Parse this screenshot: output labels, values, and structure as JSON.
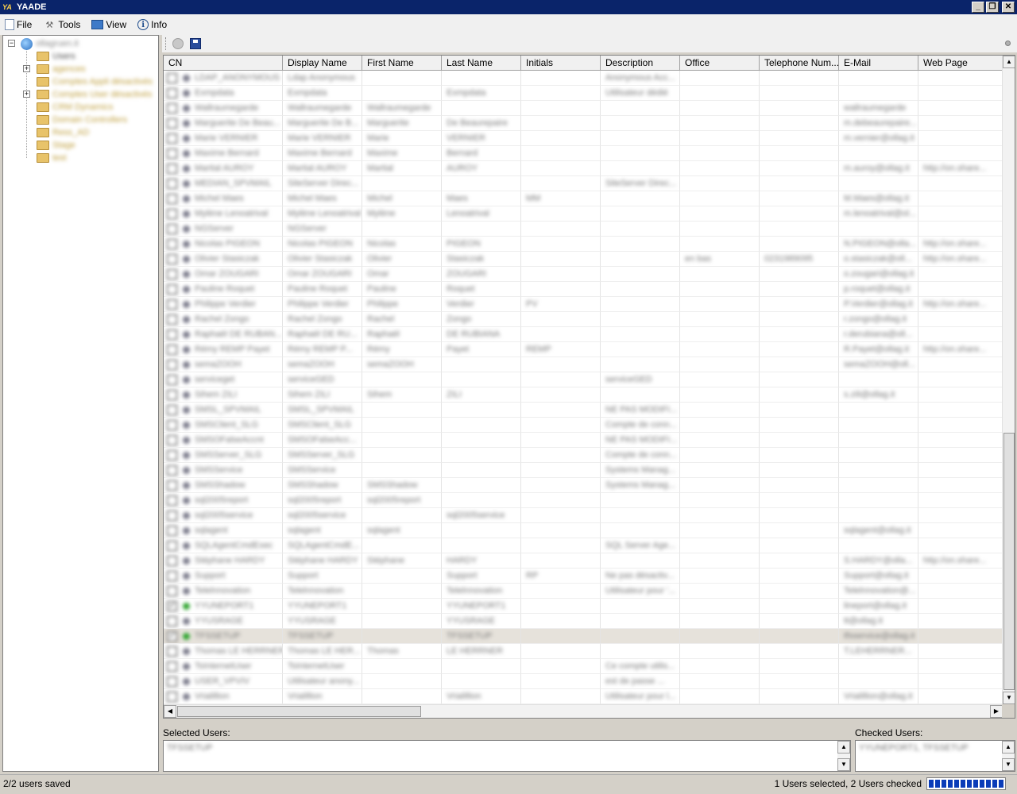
{
  "window": {
    "title": "YAADE",
    "app_icon": "YA"
  },
  "menu": [
    {
      "label": "File",
      "icon": "file-icon"
    },
    {
      "label": "Tools",
      "icon": "tools-icon"
    },
    {
      "label": "View",
      "icon": "view-icon"
    },
    {
      "label": "Info",
      "icon": "info-icon"
    }
  ],
  "tree": {
    "root": "ollagruen.it",
    "items": [
      {
        "label": "Users",
        "expandable": false,
        "selected": true
      },
      {
        "label": "agences",
        "expandable": true
      },
      {
        "label": "Comptes Appli désactivés",
        "expandable": false
      },
      {
        "label": "Comptes User désactivés",
        "expandable": true
      },
      {
        "label": "CRM Dynamics",
        "expandable": false
      },
      {
        "label": "Domain Controllers",
        "expandable": false
      },
      {
        "label": "Ress_AD",
        "expandable": false
      },
      {
        "label": "Stage",
        "expandable": false
      },
      {
        "label": "test",
        "expandable": false
      }
    ]
  },
  "grid": {
    "columns": [
      "CN",
      "Display Name",
      "First Name",
      "Last Name",
      "Initials",
      "Description",
      "Office",
      "Telephone Num...",
      "E-Mail",
      "Web Page"
    ],
    "rows": [
      {
        "checked": false,
        "active": false,
        "cells": [
          "LDAP_ANONYMOUS",
          "Ldap Anonymous",
          "",
          "",
          "",
          "Anonymous Acc...",
          "",
          "",
          "",
          ""
        ]
      },
      {
        "checked": false,
        "active": false,
        "cells": [
          "Exmpdata",
          "Exmpdata",
          "",
          "Exmpdata",
          "",
          "Utilisateur dédié",
          "",
          "",
          "",
          ""
        ]
      },
      {
        "checked": false,
        "active": false,
        "cells": [
          "Wallraumegarde",
          "Wallraumegarde",
          "Wallraumegarde",
          "",
          "",
          "",
          "",
          "",
          "wallraumegarde",
          ""
        ]
      },
      {
        "checked": false,
        "active": false,
        "cells": [
          "Marguerite De Beau...",
          "Marguerite De B...",
          "Marguerite",
          "De Beaurepaire",
          "",
          "",
          "",
          "",
          "m.debeaurepaire...",
          ""
        ]
      },
      {
        "checked": false,
        "active": false,
        "cells": [
          "Marie VERNIER",
          "Marie VERNIER",
          "Marie",
          "VERNIER",
          "",
          "",
          "",
          "",
          "m.vernier@ollag.it",
          ""
        ]
      },
      {
        "checked": false,
        "active": false,
        "cells": [
          "Maxime Bernard",
          "Maxime Bernard",
          "Maxime",
          "Bernard",
          "",
          "",
          "",
          "",
          "",
          ""
        ]
      },
      {
        "checked": false,
        "active": false,
        "cells": [
          "Martial AUROY",
          "Martial AUROY",
          "Martial",
          "AUROY",
          "",
          "",
          "",
          "",
          "m.auroy@ollag.it",
          "http://on.share..."
        ]
      },
      {
        "checked": false,
        "active": false,
        "cells": [
          "MEDIAN_SPVMAIL",
          "SiteServer Direc...",
          "",
          "",
          "",
          "SiteServer Direc...",
          "",
          "",
          "",
          ""
        ]
      },
      {
        "checked": false,
        "active": false,
        "cells": [
          "Michel Maes",
          "Michel Maes",
          "Michel",
          "Maes",
          "MM",
          "",
          "",
          "",
          "M.Maes@ollag.it",
          ""
        ]
      },
      {
        "checked": false,
        "active": false,
        "cells": [
          "Mylène Lenoatrival",
          "Mylène Lenoatrival",
          "Mylène",
          "Lenoatrival",
          "",
          "",
          "",
          "",
          "m.lenoatrival@ol...",
          ""
        ]
      },
      {
        "checked": false,
        "active": false,
        "cells": [
          "NGServer",
          "NGServer",
          "",
          "",
          "",
          "",
          "",
          "",
          "",
          ""
        ]
      },
      {
        "checked": false,
        "active": false,
        "cells": [
          "Nicolas PIGEON",
          "Nicolas PIGEON",
          "Nicolas",
          "PIGEON",
          "",
          "",
          "",
          "",
          "N.PIGEON@olla...",
          "http://on.share..."
        ]
      },
      {
        "checked": false,
        "active": false,
        "cells": [
          "Olivier Stasiczak",
          "Olivier Stasiczak",
          "Olivier",
          "Stasiczak",
          "",
          "",
          "en bas",
          "0231989095",
          "o.stasiczak@oll...",
          "http://on.share..."
        ]
      },
      {
        "checked": false,
        "active": false,
        "cells": [
          "Omar ZOUGARI",
          "Omar ZOUGARI",
          "Omar",
          "ZOUGARI",
          "",
          "",
          "",
          "",
          "o.zougari@ollag.it",
          ""
        ]
      },
      {
        "checked": false,
        "active": false,
        "cells": [
          "Pauline Roquet",
          "Pauline Roquet",
          "Pauline",
          "Roquet",
          "",
          "",
          "",
          "",
          "p.roquet@ollag.it",
          ""
        ]
      },
      {
        "checked": false,
        "active": false,
        "cells": [
          "Philippe Verdier",
          "Philippe Verdier",
          "Philippe",
          "Verdier",
          "PV",
          "",
          "",
          "",
          "P.Verdier@ollag.it",
          "http://on.share..."
        ]
      },
      {
        "checked": false,
        "active": false,
        "cells": [
          "Rachel Zongo",
          "Rachel Zongo",
          "Rachel",
          "Zongo",
          "",
          "",
          "",
          "",
          "r.zongo@ollag.it",
          ""
        ]
      },
      {
        "checked": false,
        "active": false,
        "cells": [
          "Raphaël DE RUBAN...",
          "Raphaël DE RU...",
          "Raphaël",
          "DE RUBIANA",
          "",
          "",
          "",
          "",
          "r.derubiana@oll...",
          ""
        ]
      },
      {
        "checked": false,
        "active": false,
        "cells": [
          "Rémy REMP Payet",
          "Rémy REMP P...",
          "Rémy",
          "Payet",
          "REMP",
          "",
          "",
          "",
          "R.Payet@ollag.it",
          "http://on.share..."
        ]
      },
      {
        "checked": false,
        "active": false,
        "cells": [
          "semaZOOH",
          "semaZOOH",
          "semaZOOH",
          "",
          "",
          "",
          "",
          "",
          "semaZOOH@oll...",
          ""
        ]
      },
      {
        "checked": false,
        "active": false,
        "cells": [
          "serviceget",
          "serviceGED",
          "",
          "",
          "",
          "serviceGED",
          "",
          "",
          "",
          ""
        ]
      },
      {
        "checked": false,
        "active": false,
        "cells": [
          "Sihem ZILI",
          "Sihem ZILI",
          "Sihem",
          "ZILI",
          "",
          "",
          "",
          "",
          "s.zili@ollag.it",
          ""
        ]
      },
      {
        "checked": false,
        "active": false,
        "cells": [
          "SMSL_SPVMAIL",
          "SMSL_SPVMAIL",
          "",
          "",
          "",
          "NE PAS MODIFI...",
          "",
          "",
          "",
          ""
        ]
      },
      {
        "checked": false,
        "active": false,
        "cells": [
          "SMSClient_SLG",
          "SMSClient_SLG",
          "",
          "",
          "",
          "Compte de conn...",
          "",
          "",
          "",
          ""
        ]
      },
      {
        "checked": false,
        "active": false,
        "cells": [
          "SMSOFalseAccnt",
          "SMSOFalseAcc...",
          "",
          "",
          "",
          "NE PAS MODIFI...",
          "",
          "",
          "",
          ""
        ]
      },
      {
        "checked": false,
        "active": false,
        "cells": [
          "SMSServer_SLG",
          "SMSServer_SLG",
          "",
          "",
          "",
          "Compte de conn...",
          "",
          "",
          "",
          ""
        ]
      },
      {
        "checked": false,
        "active": false,
        "cells": [
          "SMSService",
          "SMSService",
          "",
          "",
          "",
          "Systems Manag...",
          "",
          "",
          "",
          ""
        ]
      },
      {
        "checked": false,
        "active": false,
        "cells": [
          "SMSShadow",
          "SMSShadow",
          "SMSShadow",
          "",
          "",
          "Systems Manag...",
          "",
          "",
          "",
          ""
        ]
      },
      {
        "checked": false,
        "active": false,
        "cells": [
          "sql2005report",
          "sql2005report",
          "sql2005report",
          "",
          "",
          "",
          "",
          "",
          "",
          ""
        ]
      },
      {
        "checked": false,
        "active": false,
        "cells": [
          "sql2005service",
          "sql2005service",
          "",
          "sql2005service",
          "",
          "",
          "",
          "",
          "",
          ""
        ]
      },
      {
        "checked": false,
        "active": false,
        "cells": [
          "sqlagent",
          "sqlagent",
          "sqlagent",
          "",
          "",
          "",
          "",
          "",
          "sqlagent@ollag.it",
          ""
        ]
      },
      {
        "checked": false,
        "active": false,
        "cells": [
          "SQLAgentCmdExec",
          "SQLAgentCmdE...",
          "",
          "",
          "",
          "SQL Server Age...",
          "",
          "",
          "",
          ""
        ]
      },
      {
        "checked": false,
        "active": false,
        "cells": [
          "Stéphane HARDY",
          "Stéphane HARDY",
          "Stéphane",
          "HARDY",
          "",
          "",
          "",
          "",
          "S.HARDY@olla...",
          "http://on.share..."
        ]
      },
      {
        "checked": false,
        "active": false,
        "cells": [
          "Support",
          "Support",
          "",
          "Support",
          "RP",
          "Ne pas désactiv...",
          "",
          "",
          "Support@ollag.it",
          ""
        ]
      },
      {
        "checked": false,
        "active": false,
        "cells": [
          "Telelnnovation",
          "Telelnnovation",
          "",
          "Telelnnovation",
          "",
          "Utilisateur pour '...",
          "",
          "",
          "Telelnnovation@...",
          ""
        ]
      },
      {
        "checked": true,
        "active": true,
        "cells": [
          "YYUNEPORT1",
          "YYUNEPORT1",
          "",
          "YYUNEPORT1",
          "",
          "",
          "",
          "",
          "lineport@ollag.it",
          ""
        ]
      },
      {
        "checked": false,
        "active": false,
        "cells": [
          "YYUSRAGE",
          "YYUSRAGE",
          "",
          "YYUSRAGE",
          "",
          "",
          "",
          "",
          "tt@ollag.it",
          ""
        ]
      },
      {
        "checked": true,
        "active": true,
        "highlight": true,
        "cells": [
          "TFSSETUP",
          "TFSSETUP",
          "",
          "TFSSETUP",
          "",
          "",
          "",
          "",
          "tfsservice@ollag.it",
          ""
        ]
      },
      {
        "checked": false,
        "active": false,
        "cells": [
          "Thomas LE HERRNER",
          "Thomas LE HER...",
          "Thomas",
          "LE HERRNER",
          "",
          "",
          "",
          "",
          "T.LEHERRNER...",
          ""
        ]
      },
      {
        "checked": false,
        "active": false,
        "cells": [
          "TsInternetUser",
          "TsInternetUser",
          "",
          "",
          "",
          "Ce compte utilis...",
          "",
          "",
          "",
          ""
        ]
      },
      {
        "checked": false,
        "active": false,
        "cells": [
          "USER_VPVIV",
          "Utilisateur anony...",
          "",
          "",
          "",
          "est de passe ...",
          "",
          "",
          "",
          ""
        ]
      },
      {
        "checked": false,
        "active": false,
        "cells": [
          "Vrialillion",
          "Vrialillion",
          "",
          "Vrialillion",
          "",
          "Utilisateur pour l...",
          "",
          "",
          "Vrialillion@ollag.it",
          ""
        ]
      }
    ]
  },
  "bottom": {
    "selected_label": "Selected Users:",
    "selected_value": "TFSSETUP",
    "checked_label": "Checked Users:",
    "checked_value": "YYUNEPORT1, TFSSETUP"
  },
  "status": {
    "left": "2/2 users saved",
    "right": "1 Users selected, 2 Users checked",
    "progress": 1.0
  },
  "colors": {
    "titlebar": "#0a246a",
    "active_dot": "#2fa52f",
    "inactive_dot": "#7c7c8c",
    "progress": "#0a3cb8"
  }
}
